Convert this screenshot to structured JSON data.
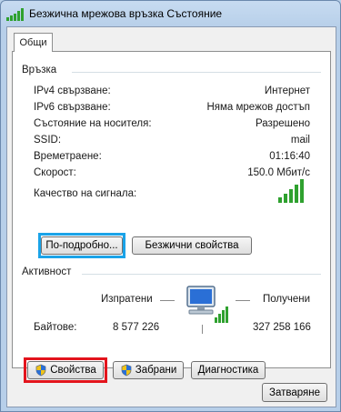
{
  "window": {
    "title": "Безжична мрежова връзка Състояние"
  },
  "tabs": [
    {
      "label": "Общи"
    }
  ],
  "connection": {
    "group_title": "Връзка",
    "rows": [
      {
        "label": "IPv4 свързване:",
        "value": "Интернет"
      },
      {
        "label": "IPv6 свързване:",
        "value": "Няма мрежов достъп"
      },
      {
        "label": "Състояние на носителя:",
        "value": "Разрешено"
      },
      {
        "label": "SSID:",
        "value": "mail"
      },
      {
        "label": "Времетраене:",
        "value": "01:16:40"
      },
      {
        "label": "Скорост:",
        "value": "150.0 Мбит/с"
      }
    ],
    "signal_label": "Качество на сигнала:",
    "signal_bars": 5,
    "details_button": "По-подробно...",
    "wireless_props_button": "Безжични свойства"
  },
  "activity": {
    "group_title": "Активност",
    "sent_label": "Изпратени",
    "received_label": "Получени",
    "bytes_label": "Байтове:",
    "bytes_sent": "8 577 226",
    "bytes_received": "327 258 166"
  },
  "buttons": {
    "properties": "Свойства",
    "disable": "Забрани",
    "diagnose": "Диагностика",
    "close": "Затваряне"
  },
  "colors": {
    "signal_green": "#2fa12f",
    "highlight_blue": "#1aa3e8",
    "highlight_red": "#e3141c"
  }
}
